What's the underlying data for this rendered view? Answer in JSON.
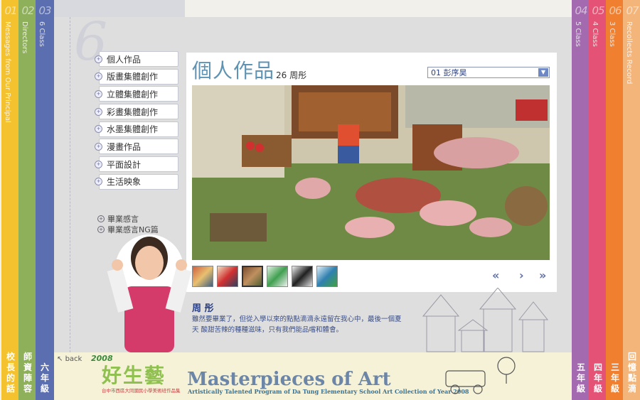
{
  "left_tabs": [
    {
      "num": "01",
      "en": "Messages from Our Principal",
      "zh": [
        "校",
        "長",
        "的",
        "話"
      ],
      "color": "#f5c22f"
    },
    {
      "num": "02",
      "en": "Directors",
      "zh": [
        "師",
        "資",
        "陣",
        "容"
      ],
      "color": "#8fb05a"
    },
    {
      "num": "03",
      "en": "6 Class",
      "zh": [
        "六",
        "年",
        "級"
      ],
      "color": "#5b6eb0"
    }
  ],
  "right_tabs": [
    {
      "num": "04",
      "en": "5 Class",
      "zh": [
        "五",
        "年",
        "級"
      ],
      "color": "#a36ab0"
    },
    {
      "num": "05",
      "en": "4 Class",
      "zh": [
        "四",
        "年",
        "級"
      ],
      "color": "#e45275"
    },
    {
      "num": "06",
      "en": "3 Class",
      "zh": [
        "三",
        "年",
        "級"
      ],
      "color": "#f08030"
    },
    {
      "num": "07",
      "en": "Recollects Record",
      "zh": [
        "回",
        "憶",
        "點",
        "滴"
      ],
      "color": "#f4b57a"
    }
  ],
  "big_number": "6",
  "menu": [
    "個人作品",
    "版畫集體創作",
    "立體集體創作",
    "彩畫集體創作",
    "水墨集體創作",
    "漫畫作品",
    "平面設計",
    "生活映象"
  ],
  "submenu": [
    "畢業感言",
    "畢業感言NG篇"
  ],
  "section_title": "個人作品",
  "student_count": "26 周彤",
  "selected_student": "01 彭序昊",
  "artist_name": "周 彤",
  "description": "雖然要畢業了，但從入學以來的點點滴滴永遠留在我心中，最後一個夏天 酸甜苦辣的種種滋味，只有我們能品嚐和體會。",
  "nav": {
    "first": "«",
    "next": "›",
    "last": "»"
  },
  "footer": {
    "back": "back",
    "year": "2008",
    "logo": "好生藝",
    "logo_sub": "台中市西區大同國民小學美術班作品集",
    "title": "Masterpieces of Art",
    "subtitle": "Artistically Talented Program of Da Tung Elementary School Art Collection of Year 2008"
  },
  "colors": {
    "title": "#5f93b3",
    "accent": "#5f6fa8"
  }
}
